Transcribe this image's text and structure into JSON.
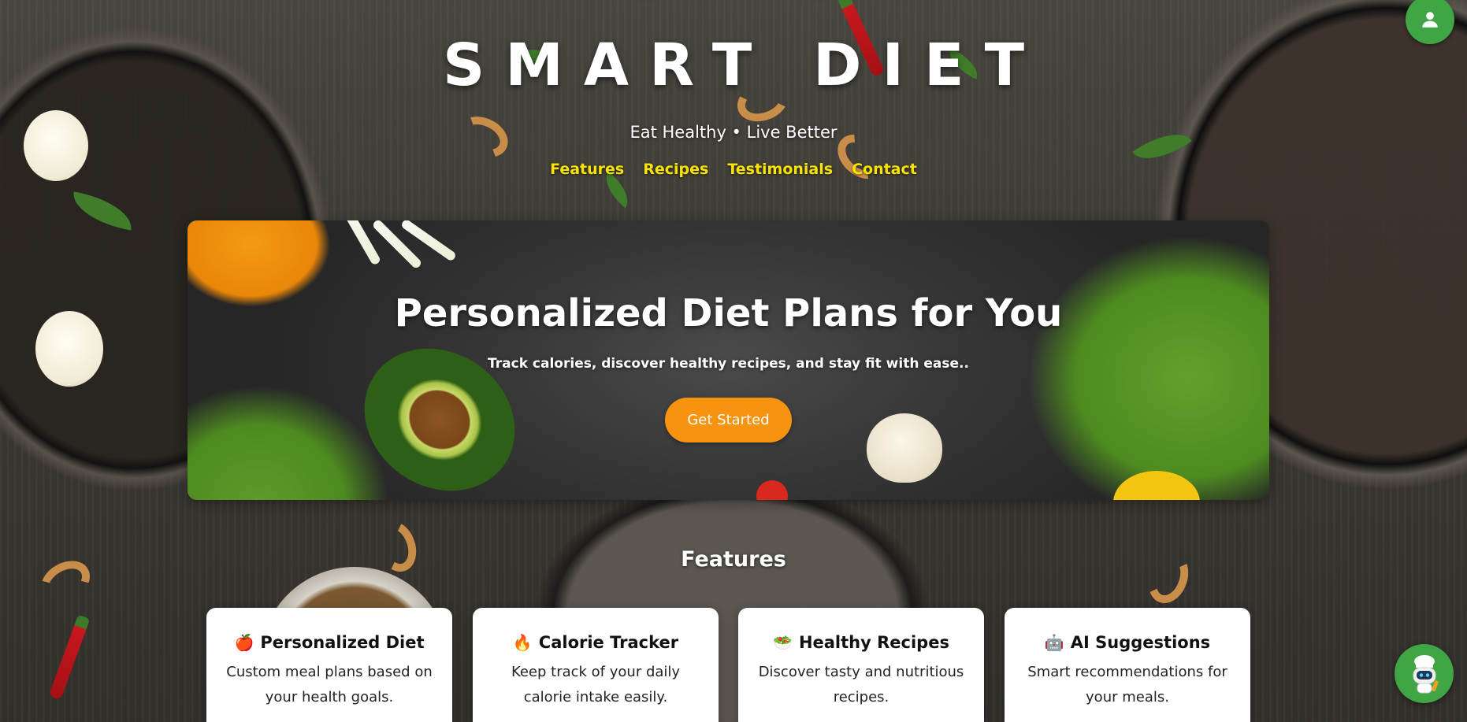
{
  "header": {
    "brand": "SMART DIET",
    "tagline": "Eat Healthy • Live Better",
    "nav": [
      {
        "label": "Features"
      },
      {
        "label": "Recipes"
      },
      {
        "label": "Testimonials"
      },
      {
        "label": "Contact"
      }
    ]
  },
  "hero": {
    "title": "Personalized Diet Plans for You",
    "subtitle": "Track calories, discover healthy recipes, and stay fit with ease..",
    "cta_label": "Get Started"
  },
  "features": {
    "heading": "Features",
    "cards": [
      {
        "emoji": "🍎",
        "title": "Personalized Diet",
        "description": "Custom meal plans based on your health goals."
      },
      {
        "emoji": "🔥",
        "title": "Calorie Tracker",
        "description": "Keep track of your daily calorie intake easily."
      },
      {
        "emoji": "🥗",
        "title": "Healthy Recipes",
        "description": "Discover tasty and nutritious recipes."
      },
      {
        "emoji": "🤖",
        "title": "AI Suggestions",
        "description": "Smart recommendations for your meals."
      }
    ]
  },
  "icons": {
    "profile": "user-icon",
    "chatbot": "chef-robot-icon"
  },
  "colors": {
    "nav_link": "#f9e400",
    "cta": "#f7930f",
    "profile_button": "#3fa545",
    "card_background": "#ffffff"
  }
}
